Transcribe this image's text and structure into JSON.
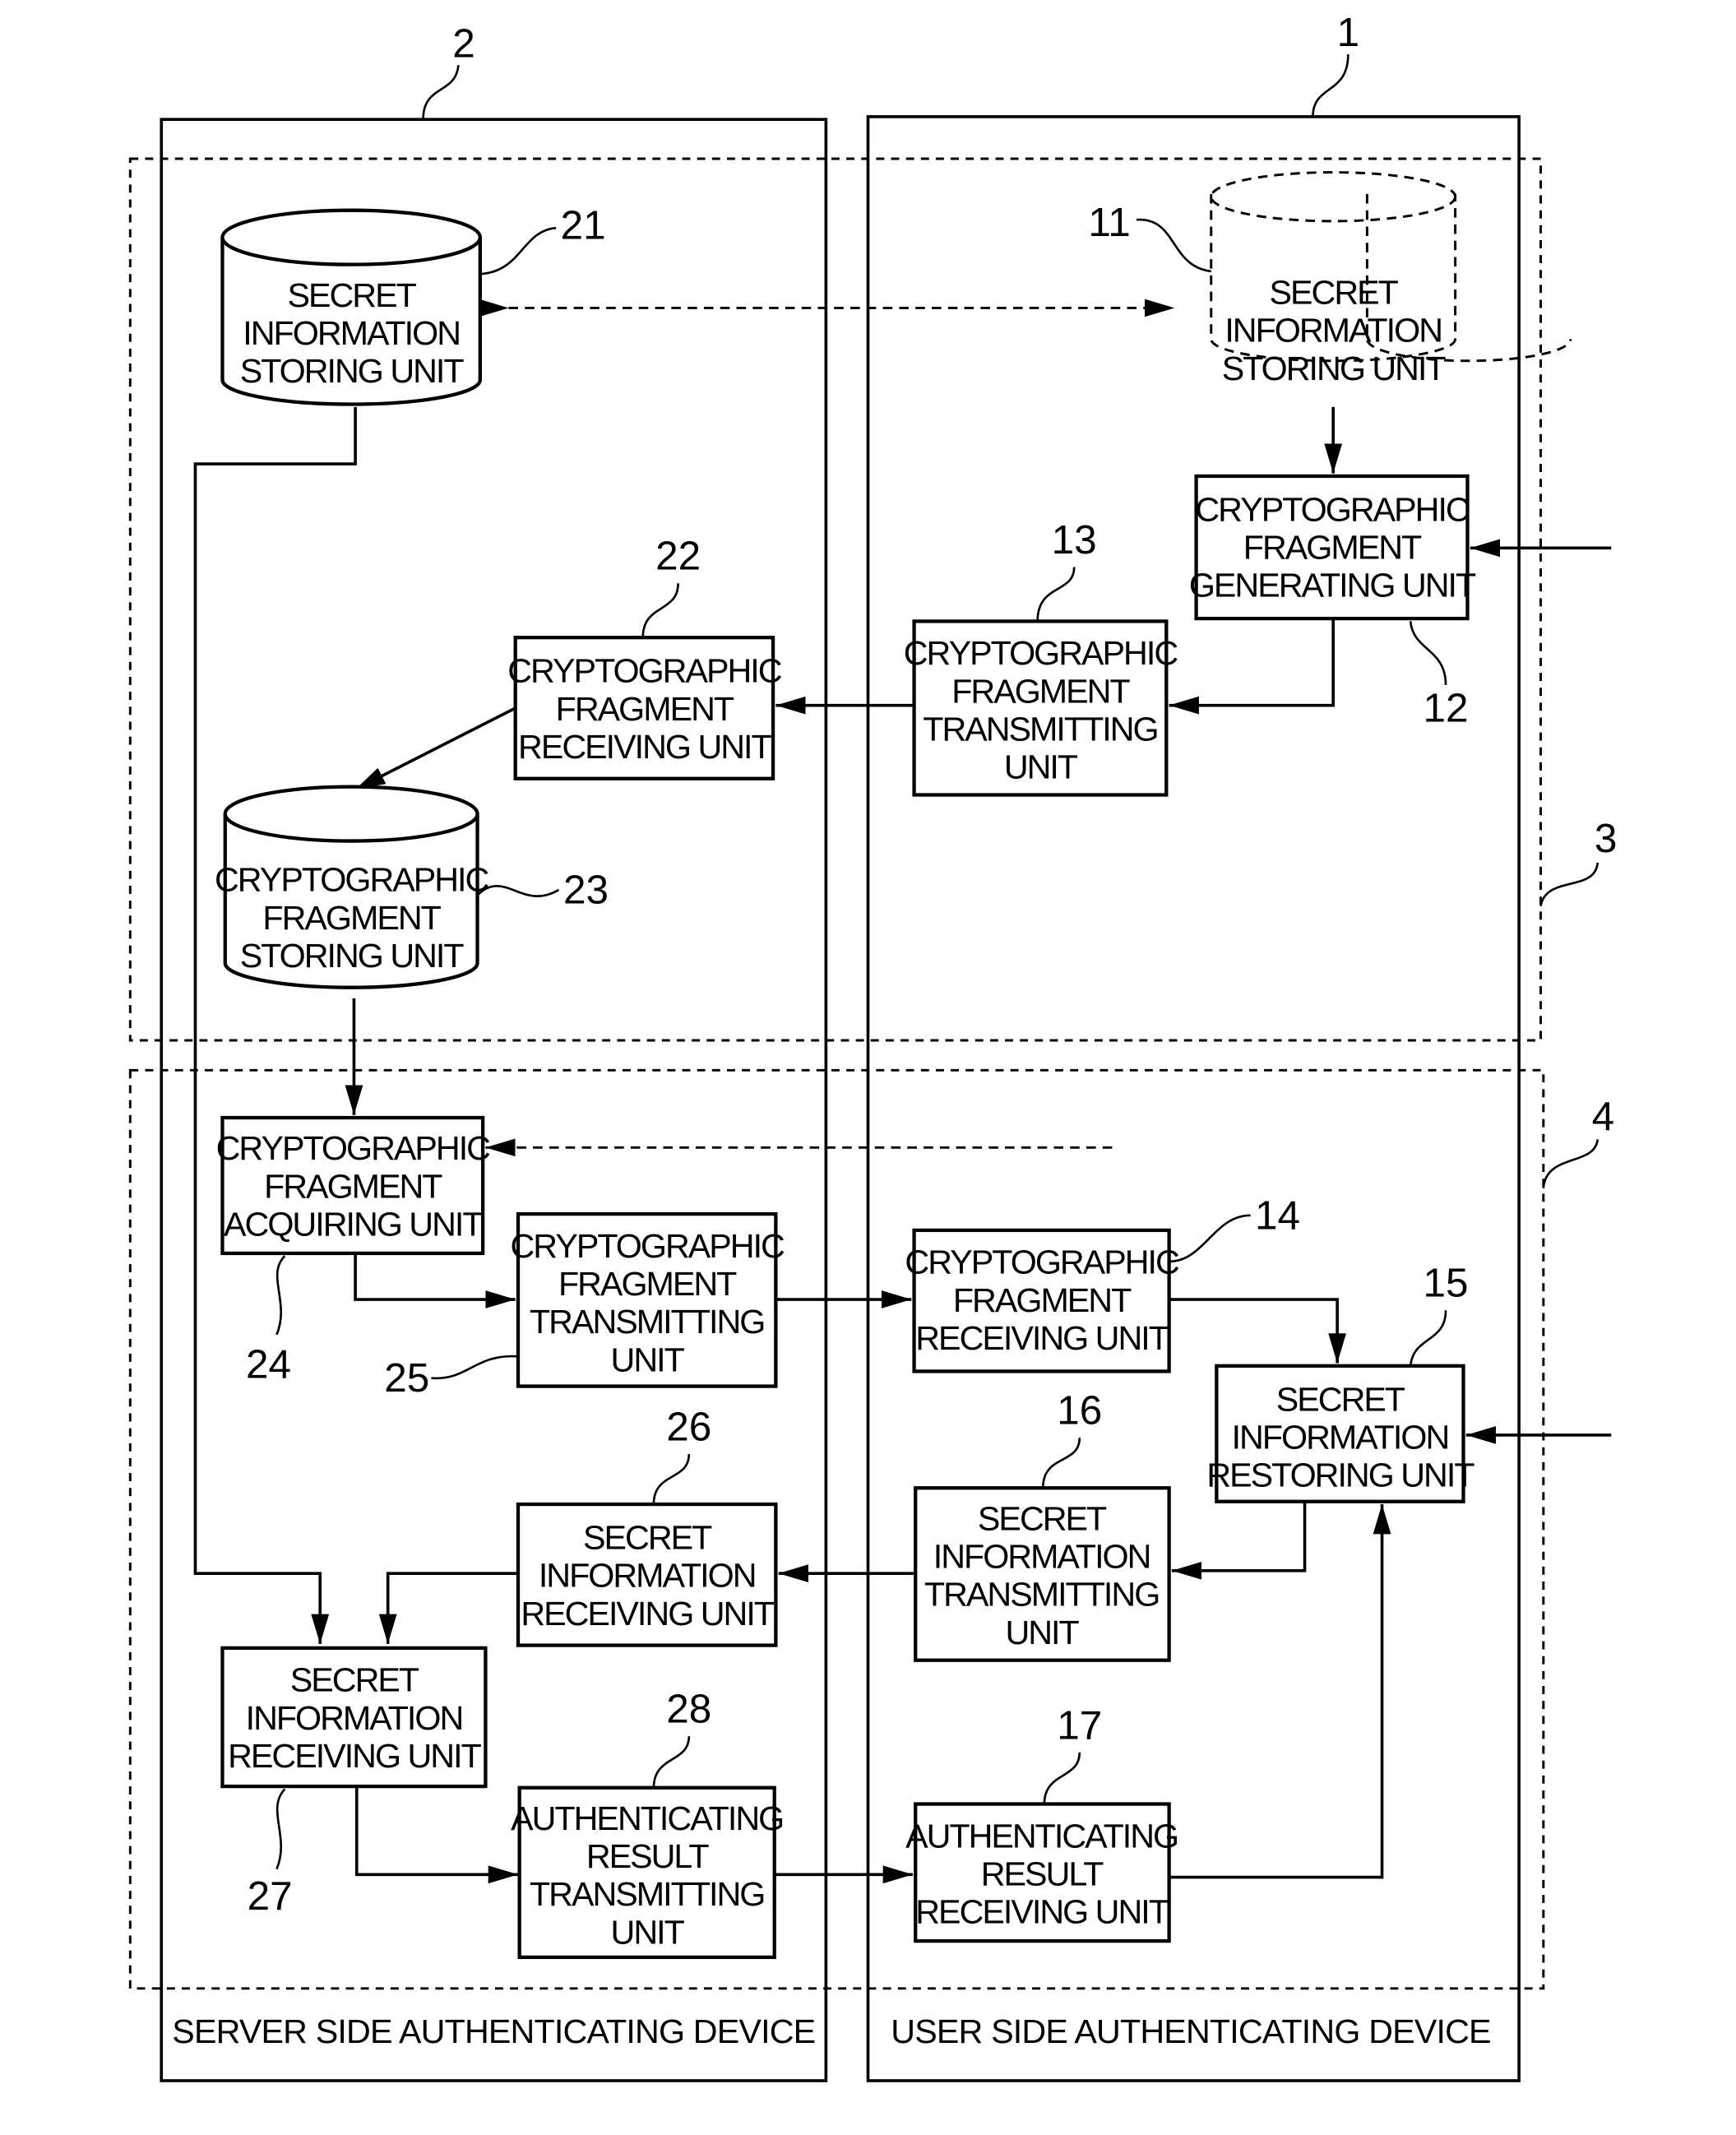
{
  "devices": {
    "server": {
      "ref": "2",
      "label": "SERVER SIDE AUTHENTICATING DEVICE"
    },
    "user": {
      "ref": "1",
      "label": "USER SIDE AUTHENTICATING DEVICE"
    }
  },
  "groups": {
    "registration": {
      "ref": "3"
    },
    "authentication": {
      "ref": "4"
    }
  },
  "units": {
    "u11": {
      "ref": "11",
      "lines": [
        "SECRET",
        "INFORMATION",
        "STORING UNIT"
      ],
      "style": "dashed-cylinder"
    },
    "u12": {
      "ref": "12",
      "lines": [
        "CRYPTOGRAPHIC",
        "FRAGMENT",
        "GENERATING UNIT"
      ]
    },
    "u13": {
      "ref": "13",
      "lines": [
        "CRYPTOGRAPHIC",
        "FRAGMENT",
        "TRANSMITTING",
        "UNIT"
      ]
    },
    "u14": {
      "ref": "14",
      "lines": [
        "CRYPTOGRAPHIC",
        "FRAGMENT",
        "RECEIVING UNIT"
      ]
    },
    "u15": {
      "ref": "15",
      "lines": [
        "SECRET",
        "INFORMATION",
        "RESTORING UNIT"
      ]
    },
    "u16": {
      "ref": "16",
      "lines": [
        "SECRET",
        "INFORMATION",
        "TRANSMITTING",
        "UNIT"
      ]
    },
    "u17": {
      "ref": "17",
      "lines": [
        "AUTHENTICATING",
        "RESULT",
        "RECEIVING UNIT"
      ]
    },
    "u21": {
      "ref": "21",
      "lines": [
        "SECRET",
        "INFORMATION",
        "STORING UNIT"
      ],
      "style": "cylinder"
    },
    "u22": {
      "ref": "22",
      "lines": [
        "CRYPTOGRAPHIC",
        "FRAGMENT",
        "RECEIVING UNIT"
      ]
    },
    "u23": {
      "ref": "23",
      "lines": [
        "CRYPTOGRAPHIC",
        "FRAGMENT",
        "STORING UNIT"
      ],
      "style": "cylinder"
    },
    "u24": {
      "ref": "24",
      "lines": [
        "CRYPTOGRAPHIC",
        "FRAGMENT",
        "ACQUIRING UNIT"
      ]
    },
    "u25": {
      "ref": "25",
      "lines": [
        "CRYPTOGRAPHIC",
        "FRAGMENT",
        "TRANSMITTING",
        "UNIT"
      ]
    },
    "u26": {
      "ref": "26",
      "lines": [
        "SECRET",
        "INFORMATION",
        "RECEIVING UNIT"
      ]
    },
    "u27": {
      "ref": "27",
      "lines": [
        "SECRET",
        "INFORMATION",
        "RECEIVING UNIT"
      ]
    },
    "u28": {
      "ref": "28",
      "lines": [
        "AUTHENTICATING",
        "RESULT",
        "TRANSMITTING",
        "UNIT"
      ]
    }
  }
}
